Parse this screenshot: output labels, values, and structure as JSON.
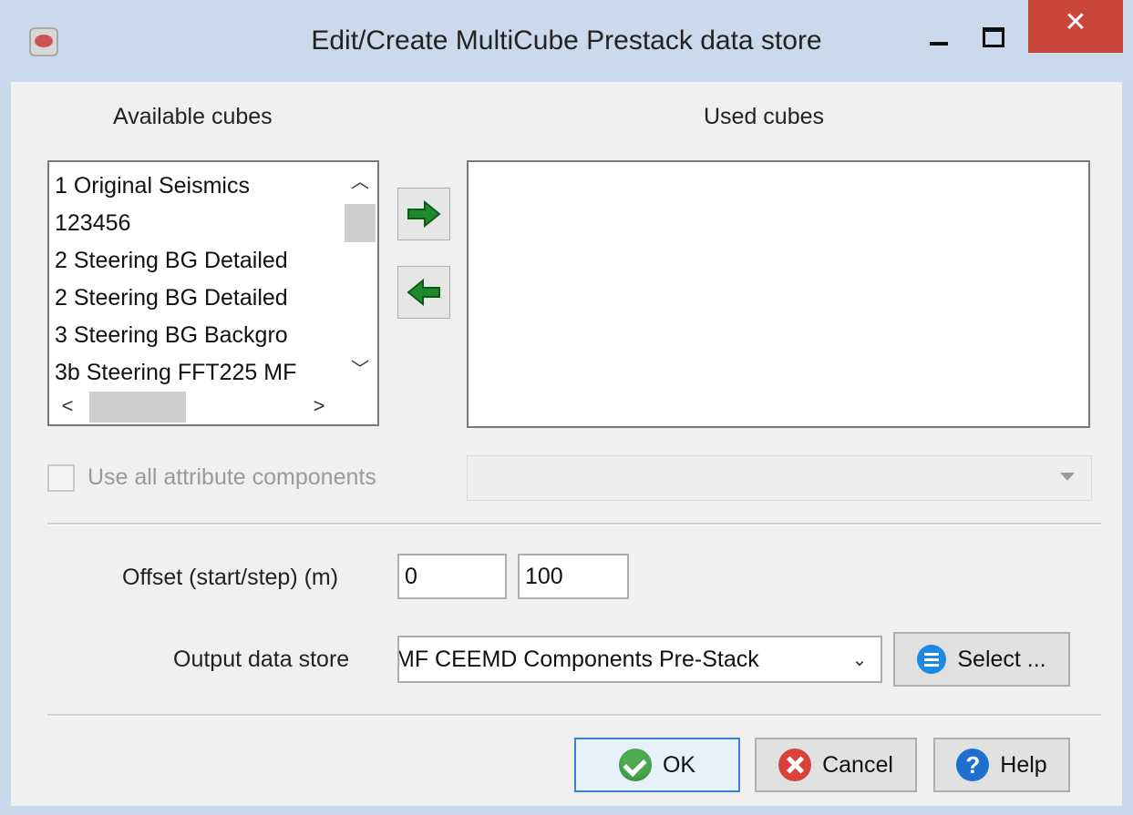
{
  "window": {
    "title": "Edit/Create MultiCube Prestack data store",
    "close_glyph": "✕"
  },
  "available": {
    "label": "Available cubes",
    "items": [
      "1 Original Seismics",
      "123456",
      "2 Steering BG Detailed",
      "2 Steering BG Detailed",
      "3 Steering BG Backgro",
      "3b Steering FFT225 MF"
    ]
  },
  "used": {
    "label": "Used cubes",
    "items": []
  },
  "options": {
    "use_all_components_label": "Use all attribute components"
  },
  "offset": {
    "label": "Offset (start/step) (m)",
    "start": "0",
    "step": "100"
  },
  "output": {
    "label": "Output data store",
    "value": "MF CEEMD Components Pre-Stack",
    "select_label": "Select ..."
  },
  "buttons": {
    "ok": "OK",
    "cancel": "Cancel",
    "help": "Help"
  },
  "icons": {
    "help_glyph": "?"
  }
}
